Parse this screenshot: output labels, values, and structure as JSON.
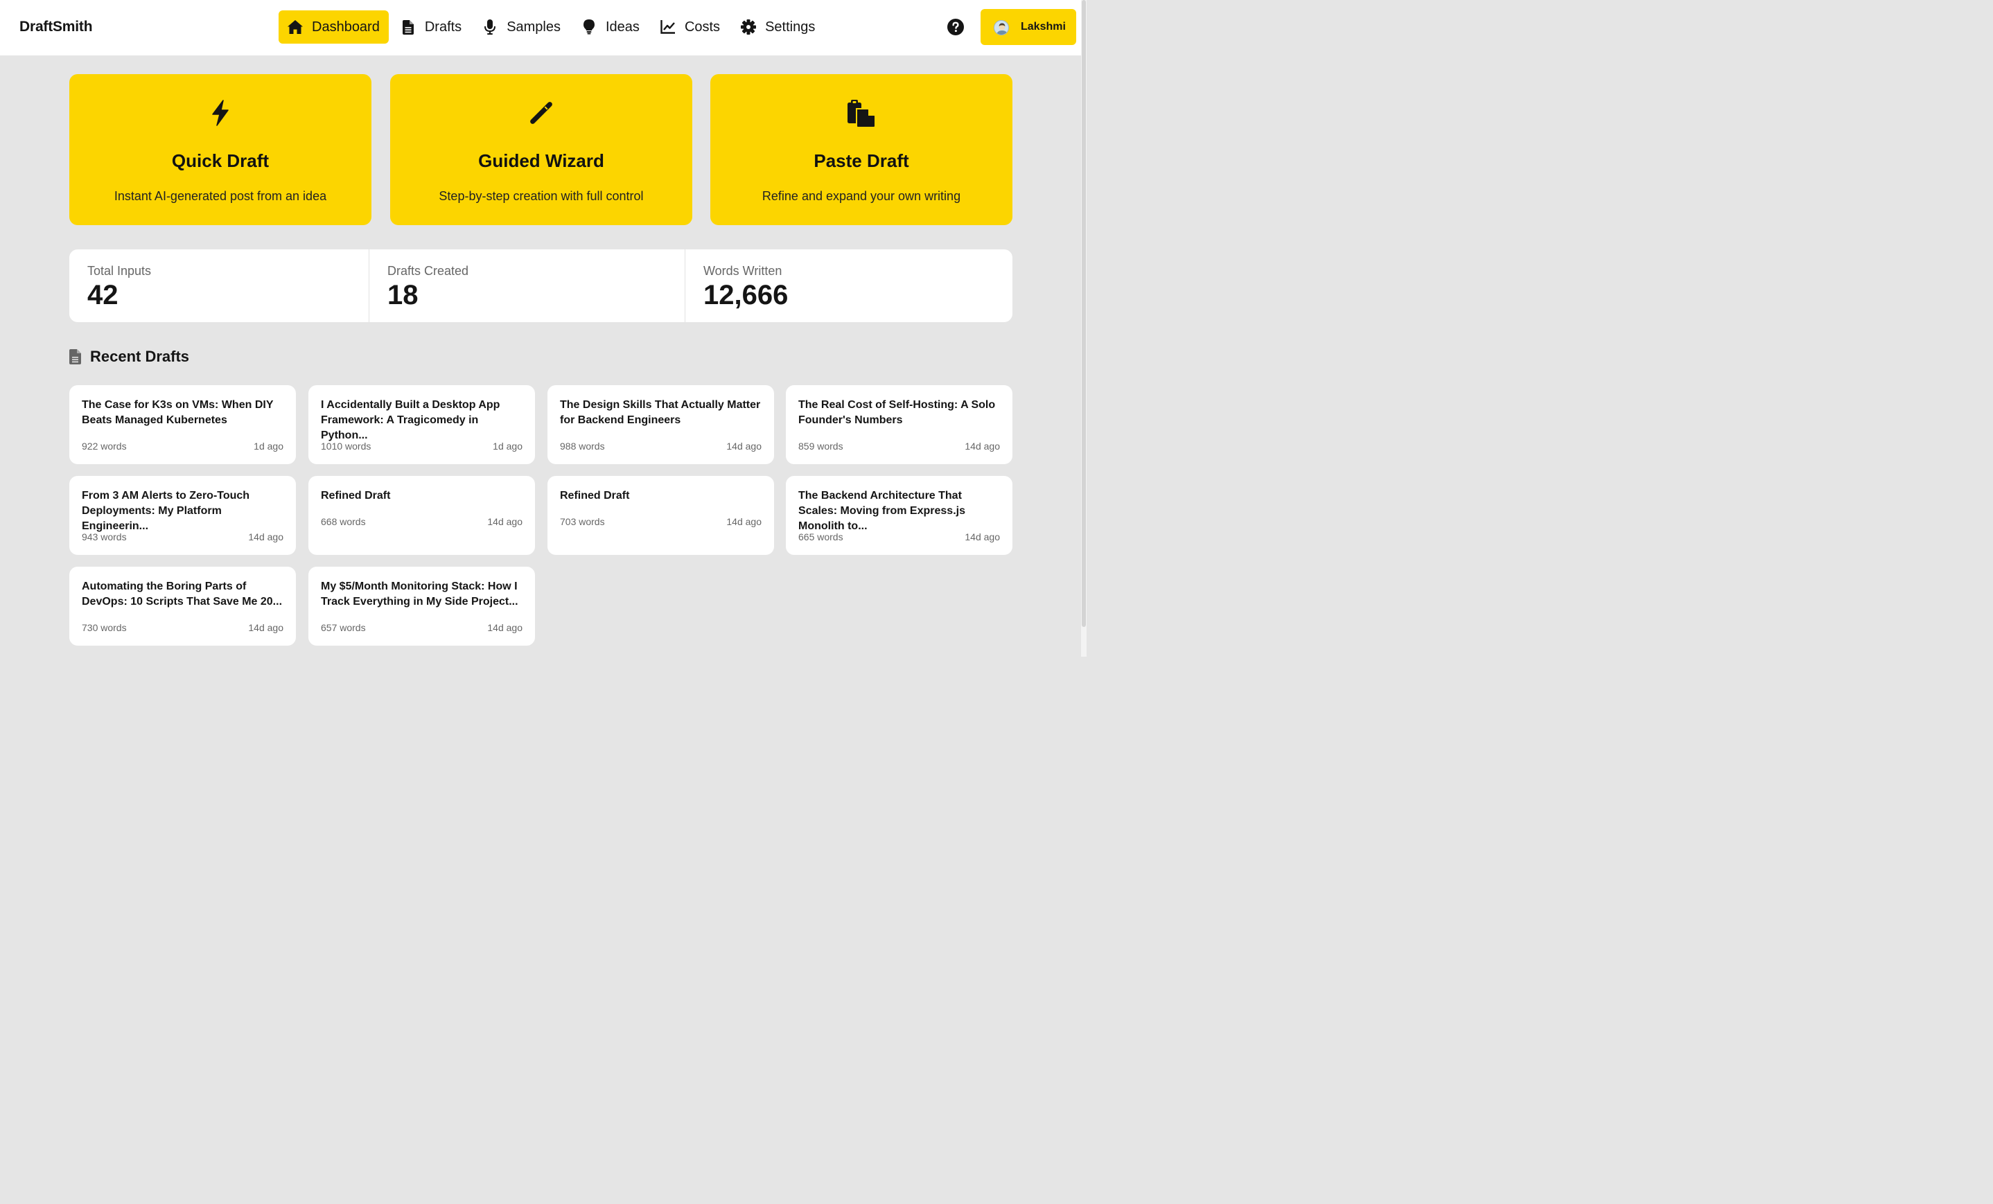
{
  "app": {
    "brand": "DraftSmith"
  },
  "nav": {
    "items": [
      {
        "label": "Dashboard",
        "icon": "home-icon",
        "active": true
      },
      {
        "label": "Drafts",
        "icon": "document-icon"
      },
      {
        "label": "Samples",
        "icon": "microphone-icon"
      },
      {
        "label": "Ideas",
        "icon": "lightbulb-icon"
      },
      {
        "label": "Costs",
        "icon": "line-chart-icon"
      },
      {
        "label": "Settings",
        "icon": "gear-icon"
      }
    ]
  },
  "header": {
    "help_icon": "help-circle-icon",
    "user_name": "Lakshmi"
  },
  "actions": [
    {
      "title": "Quick Draft",
      "desc": "Instant AI-generated post from an idea",
      "icon": "bolt-icon"
    },
    {
      "title": "Guided Wizard",
      "desc": "Step-by-step creation with full control",
      "icon": "magic-wand-icon"
    },
    {
      "title": "Paste Draft",
      "desc": "Refine and expand your own writing",
      "icon": "clipboard-paste-icon"
    }
  ],
  "stats": [
    {
      "label": "Total Inputs",
      "value": "42"
    },
    {
      "label": "Drafts Created",
      "value": "18"
    },
    {
      "label": "Words Written",
      "value": "12,666"
    }
  ],
  "recent": {
    "title": "Recent Drafts",
    "drafts": [
      {
        "title": "The Case for K3s on VMs: When DIY Beats Managed Kubernetes",
        "words": "922 words",
        "time": "1d ago"
      },
      {
        "title": "I Accidentally Built a Desktop App Framework: A Tragicomedy in Python...",
        "words": "1010 words",
        "time": "1d ago"
      },
      {
        "title": "The Design Skills That Actually Matter for Backend Engineers",
        "words": "988 words",
        "time": "14d ago"
      },
      {
        "title": "The Real Cost of Self-Hosting: A Solo Founder's Numbers",
        "words": "859 words",
        "time": "14d ago"
      },
      {
        "title": "From 3 AM Alerts to Zero-Touch Deployments: My Platform Engineerin...",
        "words": "943 words",
        "time": "14d ago"
      },
      {
        "title": "Refined Draft",
        "words": "668 words",
        "time": "14d ago"
      },
      {
        "title": "Refined Draft",
        "words": "703 words",
        "time": "14d ago"
      },
      {
        "title": "The Backend Architecture That Scales: Moving from Express.js Monolith to...",
        "words": "665 words",
        "time": "14d ago"
      },
      {
        "title": "Automating the Boring Parts of DevOps: 10 Scripts That Save Me 20...",
        "words": "730 words",
        "time": "14d ago"
      },
      {
        "title": "My $5/Month Monitoring Stack: How I Track Everything in My Side Project...",
        "words": "657 words",
        "time": "14d ago"
      }
    ]
  },
  "colors": {
    "accent": "#fcd500",
    "background": "#e5e5e5",
    "card": "#ffffff",
    "text": "#151515",
    "muted": "#666666"
  }
}
